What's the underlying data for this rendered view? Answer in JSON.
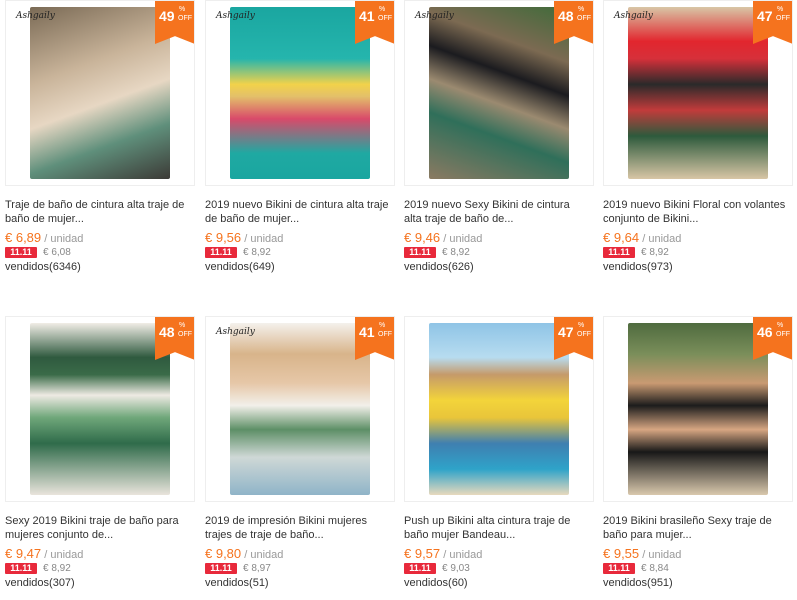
{
  "products": [
    {
      "badge_pct": "49",
      "brand": "Ashgaily",
      "title": "Traje de baño de cintura alta traje de baño de mujer...",
      "price": "€ 6,89",
      "unit": "/ unidad",
      "promo_tag": "11.11",
      "promo_price": "€ 6,08",
      "sold": "vendidos(6346)"
    },
    {
      "badge_pct": "41",
      "brand": "Ashgaily",
      "title": "2019 nuevo Bikini de cintura alta traje de baño de mujer...",
      "price": "€ 9,56",
      "unit": "/ unidad",
      "promo_tag": "11.11",
      "promo_price": "€ 8,92",
      "sold": "vendidos(649)"
    },
    {
      "badge_pct": "48",
      "brand": "Ashgaily",
      "title": "2019 nuevo Sexy Bikini de cintura alta traje de baño de...",
      "price": "€ 9,46",
      "unit": "/ unidad",
      "promo_tag": "11.11",
      "promo_price": "€ 8,92",
      "sold": "vendidos(626)"
    },
    {
      "badge_pct": "47",
      "brand": "Ashgaily",
      "title": "2019 nuevo Bikini Floral con volantes conjunto de Bikini...",
      "price": "€ 9,64",
      "unit": "/ unidad",
      "promo_tag": "11.11",
      "promo_price": "€ 8,92",
      "sold": "vendidos(973)"
    },
    {
      "badge_pct": "48",
      "brand": "",
      "title": "Sexy 2019 Bikini traje de baño para mujeres conjunto de...",
      "price": "€ 9,47",
      "unit": "/ unidad",
      "promo_tag": "11.11",
      "promo_price": "€ 8,92",
      "sold": "vendidos(307)"
    },
    {
      "badge_pct": "41",
      "brand": "Ashgaily",
      "title": "2019 de impresión Bikini mujeres trajes de traje de baño...",
      "price": "€ 9,80",
      "unit": "/ unidad",
      "promo_tag": "11.11",
      "promo_price": "€ 8,97",
      "sold": "vendidos(51)"
    },
    {
      "badge_pct": "47",
      "brand": "",
      "title": "Push up Bikini alta cintura traje de baño mujer Bandeau...",
      "price": "€ 9,57",
      "unit": "/ unidad",
      "promo_tag": "11.11",
      "promo_price": "€ 9,03",
      "sold": "vendidos(60)"
    },
    {
      "badge_pct": "46",
      "brand": "",
      "title": "2019 Bikini brasileño Sexy traje de baño para mujer...",
      "price": "€ 9,55",
      "unit": "/ unidad",
      "promo_tag": "11.11",
      "promo_price": "€ 8,84",
      "sold": "vendidos(951)"
    }
  ],
  "badge": {
    "percent_sign": "%",
    "off_label": "OFF"
  },
  "colors": {
    "accent": "#f5731e",
    "promo": "#e8293b"
  }
}
